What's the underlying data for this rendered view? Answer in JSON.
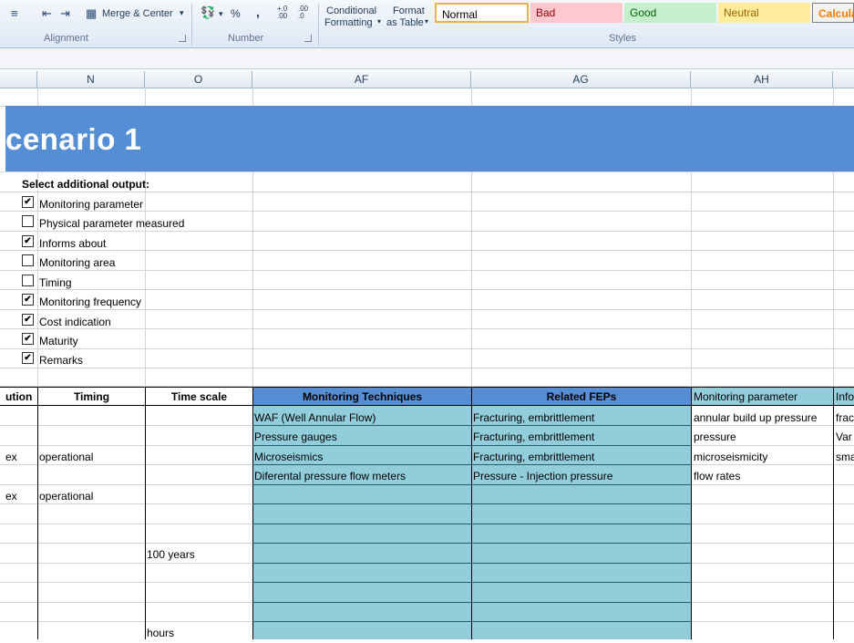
{
  "ribbon": {
    "merge_center": "Merge & Center",
    "percent": "%",
    "comma": ",",
    "inc_decimal": "+.0\n.00",
    "dec_decimal": ".00\n→.0",
    "conditional_line1": "Conditional",
    "conditional_line2": "Formatting",
    "format_line1": "Format",
    "format_line2": "as Table",
    "styles": {
      "normal": "Normal",
      "bad": "Bad",
      "good": "Good",
      "neutral": "Neutral",
      "calculation": "Calcula"
    },
    "groups": {
      "alignment": "Alignment",
      "number": "Number",
      "styles": "Styles"
    }
  },
  "columns": [
    "N",
    "O",
    "AF",
    "AG",
    "AH"
  ],
  "banner_title": "cenario 1",
  "options": {
    "title": "Select additional output:",
    "items": [
      {
        "label": "Monitoring parameter",
        "checked": true
      },
      {
        "label": "Physical parameter measured",
        "checked": false
      },
      {
        "label": "Informs about",
        "checked": true
      },
      {
        "label": "Monitoring area",
        "checked": false
      },
      {
        "label": "Timing",
        "checked": false
      },
      {
        "label": "Monitoring frequency",
        "checked": true
      },
      {
        "label": "Cost indication",
        "checked": true
      },
      {
        "label": "Maturity",
        "checked": true
      },
      {
        "label": "Remarks",
        "checked": true
      }
    ]
  },
  "table": {
    "headers": {
      "resolution": "ution",
      "timing": "Timing",
      "time_scale": "Time scale",
      "monitoring_techniques": "Monitoring Techniques",
      "related_feps": "Related FEPs",
      "monitoring_parameter": "Monitoring parameter",
      "informs": "Info"
    },
    "rows": [
      {
        "res": "",
        "timing": "",
        "scale": "",
        "technique": "WAF (Well Annular Flow)",
        "fep": "Fracturing, embrittlement",
        "param": "annular build up pressure",
        "info": "frac"
      },
      {
        "res": "",
        "timing": "",
        "scale": "",
        "technique": "Pressure gauges",
        "fep": "Fracturing, embrittlement",
        "param": "pressure",
        "info": "Var"
      },
      {
        "res": "ex",
        "timing": "operational",
        "scale": "",
        "technique": "Microseismics",
        "fep": "Fracturing, embrittlement",
        "param": "microseismicity",
        "info": "sma"
      },
      {
        "res": "",
        "timing": "",
        "scale": "",
        "technique": "Diferental pressure flow meters",
        "fep": "Pressure - Injection pressure",
        "param": "flow rates",
        "info": ""
      },
      {
        "res": "ex",
        "timing": "operational",
        "scale": "",
        "technique": "",
        "fep": "",
        "param": "",
        "info": ""
      },
      {
        "res": "",
        "timing": "",
        "scale": "",
        "technique": "",
        "fep": "",
        "param": "",
        "info": ""
      },
      {
        "res": "",
        "timing": "",
        "scale": "",
        "technique": "",
        "fep": "",
        "param": "",
        "info": ""
      },
      {
        "res": "",
        "timing": "",
        "scale": "100 years",
        "technique": "",
        "fep": "",
        "param": "",
        "info": ""
      },
      {
        "res": "",
        "timing": "",
        "scale": "",
        "technique": "",
        "fep": "",
        "param": "",
        "info": ""
      },
      {
        "res": "",
        "timing": "",
        "scale": "",
        "technique": "",
        "fep": "",
        "param": "",
        "info": ""
      },
      {
        "res": "",
        "timing": "",
        "scale": "",
        "technique": "",
        "fep": "",
        "param": "",
        "info": ""
      },
      {
        "res": "",
        "timing": "",
        "scale": "hours",
        "technique": "",
        "fep": "",
        "param": "",
        "info": ""
      }
    ]
  },
  "colors": {
    "banner": "#558ed5",
    "teal": "#92cddc",
    "bad_bg": "#ffc7ce",
    "good_bg": "#c6efce",
    "neutral_bg": "#ffeb9c"
  }
}
